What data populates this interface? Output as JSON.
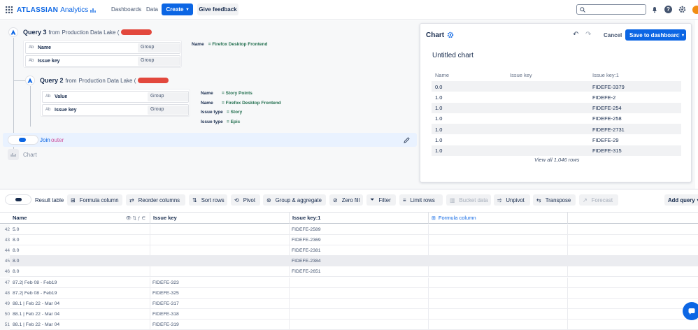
{
  "topbar": {
    "logo_word": "ATLASSIAN",
    "logo_product": "Analytics",
    "nav": [
      "Dashboards",
      "Data"
    ],
    "create": "Create",
    "feedback": "Give feedback",
    "search_placeholder": ""
  },
  "query3": {
    "title": "Query 3",
    "from": "from",
    "source": "Production Data Lake (",
    "fields": [
      {
        "tag": "Ab",
        "name": "Name",
        "agg": "Group"
      },
      {
        "tag": "Ab",
        "name": "Issue key",
        "agg": "Group"
      }
    ],
    "filters": [
      {
        "name": "Name",
        "val": "= Firefox Desktop Frontend"
      }
    ]
  },
  "query2": {
    "title": "Query 2",
    "from": "from",
    "source": "Production Data Lake (",
    "fields": [
      {
        "tag": "Ab",
        "name": "Value",
        "agg": "Group"
      },
      {
        "tag": "Ab",
        "name": "Issue key",
        "agg": "Group"
      }
    ],
    "filters": [
      {
        "name": "Name",
        "val": "= Story Points"
      },
      {
        "name": "Name",
        "val": "= Firefox Desktop Frontend"
      },
      {
        "name": "Issue type",
        "val": "= Story"
      },
      {
        "name": "Issue type",
        "val": "= Epic"
      }
    ]
  },
  "join": {
    "label": "Join",
    "type": "outer"
  },
  "chart_step": {
    "label": "Chart"
  },
  "chart": {
    "heading": "Chart",
    "cancel": "Cancel",
    "save": "Save to dashboard",
    "title": "Untitled chart",
    "columns": [
      "Name",
      "Issue key",
      "Issue key:1"
    ],
    "rows": [
      [
        "0.0",
        "",
        "FIDEFE-3379"
      ],
      [
        "1.0",
        "",
        "FIDEFE-2"
      ],
      [
        "1.0",
        "",
        "FIDEFE-254"
      ],
      [
        "1.0",
        "",
        "FIDEFE-258"
      ],
      [
        "1.0",
        "",
        "FIDEFE-2731"
      ],
      [
        "1.0",
        "",
        "FIDEFE-29"
      ],
      [
        "1.0",
        "",
        "FIDEFE-315"
      ]
    ],
    "view_all": "View all 1,046 rows"
  },
  "toolbar": {
    "result_table": "Result table",
    "items": [
      "Formula column",
      "Reorder columns",
      "Sort rows",
      "Pivot",
      "Group & aggregate",
      "Zero fill",
      "Filter",
      "Limit rows",
      "Bucket data",
      "Unpivot",
      "Transpose",
      "Forecast"
    ],
    "add_query": "Add query"
  },
  "grid": {
    "headers": [
      "Name",
      "Issue key",
      "Issue key:1",
      "Formula column"
    ],
    "rows": [
      {
        "n": "42",
        "name": "5.0",
        "key": "",
        "key1": "FIDEFE-2589"
      },
      {
        "n": "43",
        "name": "8.0",
        "key": "",
        "key1": "FIDEFE-2369"
      },
      {
        "n": "44",
        "name": "8.0",
        "key": "",
        "key1": "FIDEFE-2381"
      },
      {
        "n": "45",
        "name": "8.0",
        "key": "",
        "key1": "FIDEFE-2384"
      },
      {
        "n": "46",
        "name": "8.0",
        "key": "",
        "key1": "FIDEFE-2651"
      },
      {
        "n": "47",
        "name": "87.2| Feb 08 - Feb19",
        "key": "FIDEFE-323",
        "key1": ""
      },
      {
        "n": "48",
        "name": "87.2| Feb 08 - Feb19",
        "key": "FIDEFE-325",
        "key1": ""
      },
      {
        "n": "49",
        "name": "88.1 | Feb 22 - Mar 04",
        "key": "FIDEFE-317",
        "key1": ""
      },
      {
        "n": "50",
        "name": "88.1 | Feb 22 - Mar 04",
        "key": "FIDEFE-318",
        "key1": ""
      },
      {
        "n": "51",
        "name": "88.1 | Feb 22 - Mar 04",
        "key": "FIDEFE-319",
        "key1": ""
      }
    ]
  },
  "colors": {
    "brand": "#0c66e4",
    "green": "#216e4e",
    "redact": "#e2483d",
    "purple": "#cd519d"
  }
}
